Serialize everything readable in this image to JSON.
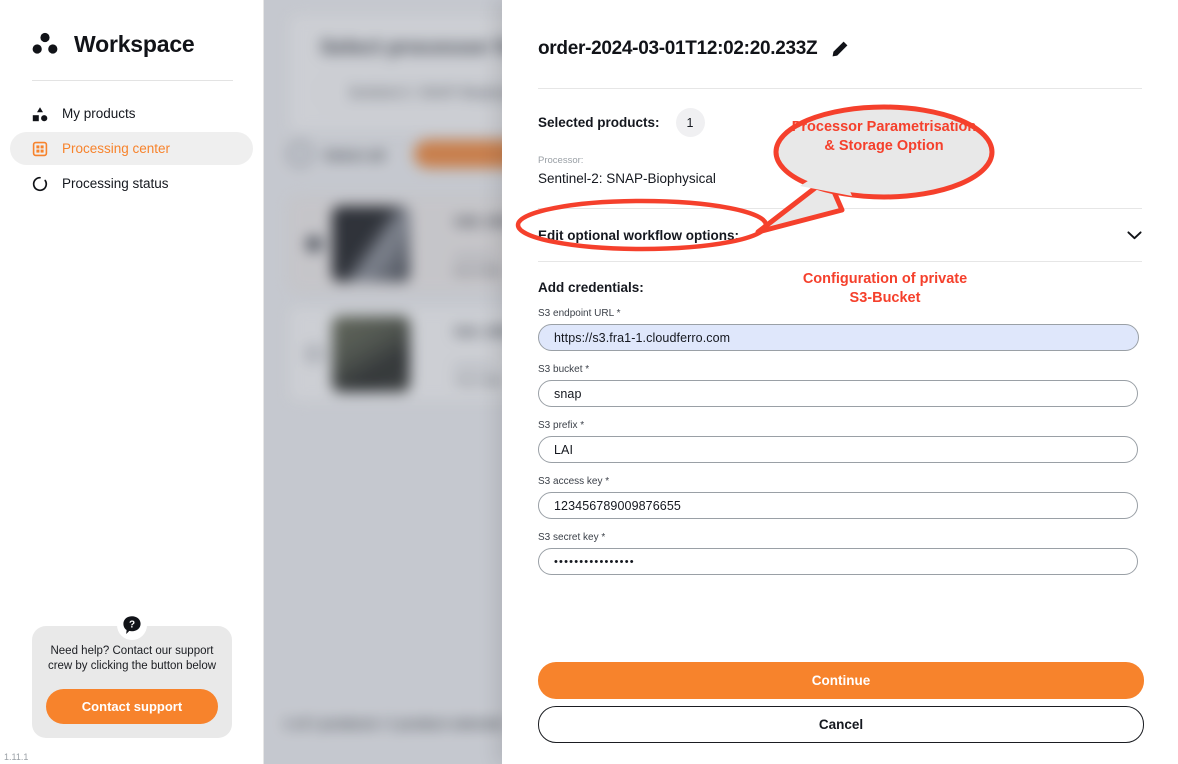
{
  "sidebar": {
    "workspace_title": "Workspace",
    "logo_icon": "three-dots-triangle-icon",
    "items": [
      {
        "label": "My products",
        "icon": "shapes-icon",
        "active": false
      },
      {
        "label": "Processing center",
        "icon": "grid-chip-icon",
        "active": true
      },
      {
        "label": "Processing status",
        "icon": "circle-spinner-icon",
        "active": false
      }
    ],
    "help": {
      "icon": "question-mark-icon",
      "text": "Need help? Contact our support crew by clicking the button below",
      "button_label": "Contact support"
    },
    "version": "1.11.1"
  },
  "backdrop": {
    "heading": "Select processor from the list",
    "processor_select_value": "Sentinel-2: SNAP-Biophysical",
    "select_all_label": "Select all",
    "action_button_label": "Start processing order",
    "footer_text": "1 of 1 products / 1 product selected",
    "rows": [
      {
        "title": "S2B_MSIL2A_20240301T...",
        "meta1": "Sentinel-2",
        "meta2": "611.8 MB",
        "selected": true
      },
      {
        "title": "S2A_MSIL2A_20240229T...",
        "meta1": "Sentinel-2",
        "meta2": "742.3 MB",
        "selected": false
      }
    ]
  },
  "panel": {
    "title": "order-2024-03-01T12:02:20.233Z",
    "edit_icon": "pencil-icon",
    "selected_products_label": "Selected products:",
    "selected_products_count": "1",
    "processor_caption": "Processor:",
    "processor_value": "Sentinel-2: SNAP-Biophysical",
    "accordion_label": "Edit optional workflow options:",
    "accordion_icon": "chevron-down-icon",
    "add_credentials_label": "Add credentials:",
    "fields": [
      {
        "label": "S3 endpoint URL *",
        "value": "https://s3.fra1-1.cloudferro.com",
        "focused": true,
        "secret": false
      },
      {
        "label": "S3 bucket *",
        "value": "snap",
        "focused": false,
        "secret": false
      },
      {
        "label": "S3 prefix *",
        "value": "LAI",
        "focused": false,
        "secret": false
      },
      {
        "label": "S3 access key *",
        "value": "123456789009876655",
        "focused": false,
        "secret": false
      },
      {
        "label": "S3 secret key *",
        "value": "••••••••••••••••",
        "focused": false,
        "secret": true
      }
    ],
    "continue_label": "Continue",
    "cancel_label": "Cancel"
  },
  "annotations": {
    "bubble_text": "Processor Parametrisation & Storage Option",
    "s3_text": "Configuration of private S3-Bucket",
    "accent_color": "#f5402c"
  },
  "colors": {
    "brand_orange": "#f7832c",
    "annotation_red": "#f5402c",
    "focused_field_bg": "#dfe7fb",
    "active_nav_bg": "#efefef"
  }
}
